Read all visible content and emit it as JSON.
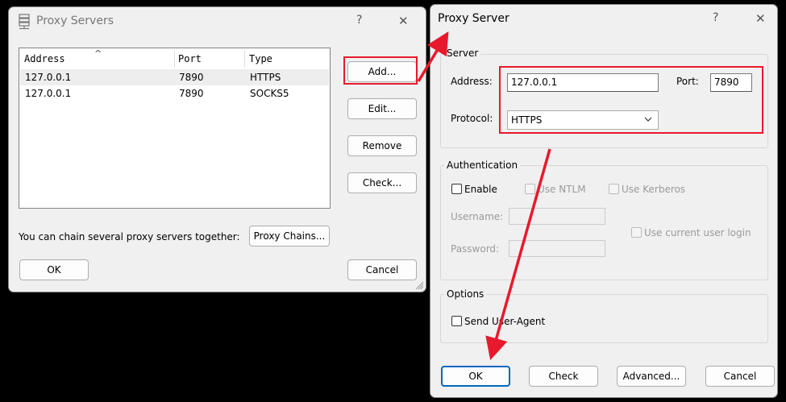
{
  "proxy_servers_dialog": {
    "title": "Proxy Servers",
    "help_glyph": "?",
    "close_glyph": "✕",
    "list": {
      "columns": [
        "Address",
        "Port",
        "Type"
      ],
      "rows": [
        {
          "address": "127.0.0.1",
          "port": "7890",
          "type": "HTTPS"
        },
        {
          "address": "127.0.0.1",
          "port": "7890",
          "type": "SOCKS5"
        }
      ]
    },
    "buttons": {
      "add": "Add...",
      "edit": "Edit...",
      "remove": "Remove",
      "check": "Check..."
    },
    "chain_text": "You can chain several proxy servers together:",
    "proxy_chains_button": "Proxy Chains...",
    "ok": "OK",
    "cancel": "Cancel"
  },
  "proxy_server_dialog": {
    "title": "Proxy Server",
    "help_glyph": "?",
    "close_glyph": "✕",
    "server": {
      "group_title": "Server",
      "address_label": "Address:",
      "address_value": "127.0.0.1",
      "port_label": "Port:",
      "port_value": "7890",
      "protocol_label": "Protocol:",
      "protocol_value": "HTTPS"
    },
    "authentication": {
      "group_title": "Authentication",
      "enable_label": "Enable",
      "use_ntlm_label": "Use NTLM",
      "use_kerberos_label": "Use Kerberos",
      "username_label": "Username:",
      "password_label": "Password:",
      "use_current_login_label": "Use current user login"
    },
    "options": {
      "group_title": "Options",
      "send_user_agent_label": "Send User-Agent"
    },
    "buttons": {
      "ok": "OK",
      "check": "Check",
      "advanced": "Advanced...",
      "cancel": "Cancel"
    }
  },
  "annotation_color": "#e8192c"
}
